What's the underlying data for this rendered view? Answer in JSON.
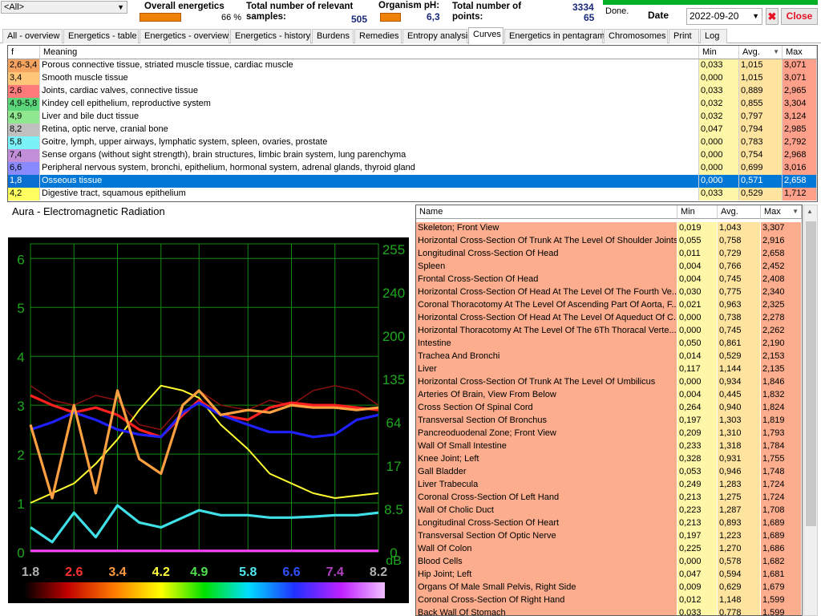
{
  "header": {
    "filter_select": "<All>",
    "overall_energetics_label": "Overall energetics",
    "overall_energetics_value": "66 %",
    "overall_energetics_level": 0.66,
    "relevant_samples_label": "Total number of relevant samples:",
    "relevant_samples_value": "505",
    "organism_ph_label": "Organism pH:",
    "organism_ph_value": "6,3",
    "total_points_label": "Total number of points:",
    "total_points_value_top": "3334",
    "total_points_value": "65",
    "status": "Done.",
    "date_label": "Date",
    "date_value": "2022-09-20",
    "close_label": "Close",
    "colors": {
      "swatch": "#f0820a",
      "progress": "#06b025",
      "close_x": "#e81123"
    }
  },
  "tabs": [
    {
      "label": "All - overview"
    },
    {
      "label": "Energetics - table"
    },
    {
      "label": "Energetics - overview"
    },
    {
      "label": "Energetics - history"
    },
    {
      "label": "Burdens"
    },
    {
      "label": "Remedies"
    },
    {
      "label": "Entropy analysis"
    },
    {
      "label": "Curves",
      "active": true
    },
    {
      "label": "Energetics in pentagram"
    },
    {
      "label": "Chromosomes"
    },
    {
      "label": "Print"
    },
    {
      "label": "Log"
    }
  ],
  "frequency_table": {
    "columns": [
      "f",
      "Meaning",
      "Min",
      "Avg.",
      "Max"
    ],
    "rows": [
      {
        "f": "2,6-3,4",
        "meaning": "Porous connective tissue, striated muscle tissue, cardiac muscle",
        "min": "0,033",
        "avg": "1,015",
        "max": "3,071",
        "color": "#f4a460"
      },
      {
        "f": "3,4",
        "meaning": "Smooth muscle tissue",
        "min": "0,000",
        "avg": "1,015",
        "max": "3,071",
        "color": "#ffc67a"
      },
      {
        "f": "2,6",
        "meaning": "Joints, cardiac valves, connective tissue",
        "min": "0,033",
        "avg": "0,889",
        "max": "2,965",
        "color": "#ff7b7b"
      },
      {
        "f": "4,9-5,8",
        "meaning": "Kindey cell epithelium, reproductive system",
        "min": "0,032",
        "avg": "0,855",
        "max": "3,304",
        "color": "#5bd67a"
      },
      {
        "f": "4,9",
        "meaning": "Liver and bile duct tissue",
        "min": "0,032",
        "avg": "0,797",
        "max": "3,124",
        "color": "#8fe78f"
      },
      {
        "f": "8,2",
        "meaning": "Retina, optic nerve, cranial bone",
        "min": "0,047",
        "avg": "0,794",
        "max": "2,985",
        "color": "#c0c0c0"
      },
      {
        "f": "5,8",
        "meaning": "Goitre, lymph, upper airways, lymphatic system, spleen, ovaries, prostate",
        "min": "0,000",
        "avg": "0,783",
        "max": "2,792",
        "color": "#7af2f7"
      },
      {
        "f": "7,4",
        "meaning": "Sense organs (without sight strength), brain structures, limbic brain system, lung parenchyma",
        "min": "0,000",
        "avg": "0,754",
        "max": "2,968",
        "color": "#c38ed8"
      },
      {
        "f": "6,6",
        "meaning": "Peripheral nervous system, bronchi, epithelium, hormonal system, adrenal glands, thyroid gland",
        "min": "0,000",
        "avg": "0,699",
        "max": "3,016",
        "color": "#8a8aff"
      },
      {
        "f": "1,8",
        "meaning": "Osseous tissue",
        "min": "0,000",
        "avg": "0,571",
        "max": "2,658",
        "color": "#0a6fd0",
        "selected": true
      },
      {
        "f": "4,2",
        "meaning": "Digestive tract, squamous epithelium",
        "min": "0,033",
        "avg": "0,529",
        "max": "1,712",
        "color": "#ffff60"
      }
    ]
  },
  "chart_title": "Aura - Electromagnetic Radiation",
  "chart_data": {
    "type": "line",
    "x": [
      1.8,
      2.2,
      2.6,
      3.0,
      3.4,
      3.8,
      4.2,
      4.6,
      4.9,
      5.3,
      5.8,
      6.2,
      6.6,
      7.0,
      7.4,
      7.8,
      8.2
    ],
    "x_ticks": [
      "1.8",
      "2.6",
      "3.4",
      "4.2",
      "4.9",
      "5.8",
      "6.6",
      "7.4",
      "8.2"
    ],
    "x_tick_colors": [
      "#b0b0b0",
      "#ff3030",
      "#ff9a40",
      "#ffff40",
      "#50e050",
      "#50e8f0",
      "#3050ff",
      "#b040c0",
      "#b0b0b0"
    ],
    "y_left_ticks": [
      "0",
      "1",
      "2",
      "3",
      "4",
      "5",
      "6"
    ],
    "y_right_ticks": [
      "0",
      "8.5",
      "17",
      "64",
      "135",
      "200",
      "240",
      "255"
    ],
    "y_right_unit": "dB",
    "ylim": [
      0,
      6.3
    ],
    "grid": true,
    "series": [
      {
        "color": "#ffff30",
        "values": [
          1.0,
          1.2,
          1.4,
          1.8,
          2.3,
          2.9,
          3.4,
          3.3,
          3.15,
          2.6,
          2.1,
          1.6,
          1.4,
          1.2,
          1.1,
          1.15,
          1.2
        ]
      },
      {
        "color": "#ff2020",
        "values": [
          3.2,
          3.0,
          2.85,
          2.95,
          2.8,
          2.5,
          2.35,
          2.8,
          3.1,
          2.8,
          2.7,
          2.95,
          3.05,
          3.0,
          3.0,
          2.95,
          2.9
        ]
      },
      {
        "color": "#2020ff",
        "values": [
          2.5,
          2.65,
          2.85,
          2.7,
          2.5,
          2.4,
          2.35,
          2.85,
          3.05,
          2.8,
          2.6,
          2.45,
          2.45,
          2.35,
          2.4,
          2.7,
          2.8
        ]
      },
      {
        "color": "#ffa040",
        "values": [
          2.6,
          1.1,
          3.0,
          1.2,
          3.3,
          1.9,
          1.6,
          3.0,
          3.3,
          2.8,
          2.9,
          2.85,
          3.0,
          2.95,
          2.95,
          2.9,
          2.95
        ]
      },
      {
        "color": "#40e0e8",
        "values": [
          0.5,
          0.2,
          0.8,
          0.3,
          0.95,
          0.6,
          0.5,
          0.7,
          0.85,
          0.75,
          0.75,
          0.7,
          0.7,
          0.72,
          0.75,
          0.75,
          0.8
        ]
      },
      {
        "color": "#ff40ff",
        "values": [
          0.02,
          0.02,
          0.02,
          0.02,
          0.02,
          0.02,
          0.02,
          0.02,
          0.02,
          0.02,
          0.02,
          0.02,
          0.02,
          0.02,
          0.02,
          0.02,
          0.02
        ]
      },
      {
        "color": "#8a1010",
        "values": [
          3.4,
          3.1,
          3.0,
          3.2,
          3.1,
          2.6,
          2.5,
          3.0,
          3.3,
          3.0,
          2.9,
          3.1,
          3.0,
          3.3,
          3.4,
          3.3,
          3.0
        ]
      }
    ]
  },
  "organ_table": {
    "columns": [
      "Name",
      "Min",
      "Avg.",
      "Max"
    ],
    "rows": [
      {
        "name": "Skeleton; Front View",
        "min": "0,019",
        "avg": "1,043",
        "max": "3,307"
      },
      {
        "name": "Horizontal Cross-Section Of Trunk At The Level Of Shoulder Joints",
        "min": "0,055",
        "avg": "0,758",
        "max": "2,916"
      },
      {
        "name": "Longitudinal Cross-Section Of Head",
        "min": "0,011",
        "avg": "0,729",
        "max": "2,658"
      },
      {
        "name": "Spleen",
        "min": "0,004",
        "avg": "0,766",
        "max": "2,452"
      },
      {
        "name": "Frontal Cross-Section Of Head",
        "min": "0,004",
        "avg": "0,745",
        "max": "2,408"
      },
      {
        "name": "Horizontal Cross-Section Of Head At The Level Of The Fourth Ve...",
        "min": "0,030",
        "avg": "0,775",
        "max": "2,340"
      },
      {
        "name": "Coronal Thoracotomy At The Level Of Ascending Part Of Aorta, F...",
        "min": "0,021",
        "avg": "0,963",
        "max": "2,325"
      },
      {
        "name": "Horizontal Cross-Section Of Head At The Level Of Aqueduct Of C...",
        "min": "0,000",
        "avg": "0,738",
        "max": "2,278"
      },
      {
        "name": "Horizontal Thoracotomy At The Level Of The 6Th Thoracal Verte...",
        "min": "0,000",
        "avg": "0,745",
        "max": "2,262"
      },
      {
        "name": "Intestine",
        "min": "0,050",
        "avg": "0,861",
        "max": "2,190"
      },
      {
        "name": "Trachea And Bronchi",
        "min": "0,014",
        "avg": "0,529",
        "max": "2,153"
      },
      {
        "name": "Liver",
        "min": "0,117",
        "avg": "1,144",
        "max": "2,135"
      },
      {
        "name": "Horizontal Cross-Section Of Trunk At The Level Of Umbilicus",
        "min": "0,000",
        "avg": "0,934",
        "max": "1,846"
      },
      {
        "name": "Arteries Of Brain, View From Below",
        "min": "0,004",
        "avg": "0,445",
        "max": "1,832"
      },
      {
        "name": "Cross Section Of Spinal Cord",
        "min": "0,264",
        "avg": "0,940",
        "max": "1,824"
      },
      {
        "name": "Transversal Section Of Bronchus",
        "min": "0,197",
        "avg": "1,303",
        "max": "1,819"
      },
      {
        "name": "Pancreoduodenal Zone; Front View",
        "min": "0,209",
        "avg": "1,310",
        "max": "1,793"
      },
      {
        "name": "Wall Of Small Intestine",
        "min": "0,233",
        "avg": "1,318",
        "max": "1,784"
      },
      {
        "name": "Knee Joint; Left",
        "min": "0,328",
        "avg": "0,931",
        "max": "1,755"
      },
      {
        "name": "Gall Bladder",
        "min": "0,053",
        "avg": "0,946",
        "max": "1,748"
      },
      {
        "name": "Liver Trabecula",
        "min": "0,249",
        "avg": "1,283",
        "max": "1,724"
      },
      {
        "name": "Coronal Cross-Section Of Left Hand",
        "min": "0,213",
        "avg": "1,275",
        "max": "1,724"
      },
      {
        "name": "Wall Of Cholic Duct",
        "min": "0,223",
        "avg": "1,287",
        "max": "1,708"
      },
      {
        "name": "Longitudinal Cross-Section Of Heart",
        "min": "0,213",
        "avg": "0,893",
        "max": "1,689"
      },
      {
        "name": "Transversal Section Of Optic Nerve",
        "min": "0,197",
        "avg": "1,223",
        "max": "1,689"
      },
      {
        "name": "Wall Of Colon",
        "min": "0,225",
        "avg": "1,270",
        "max": "1,686"
      },
      {
        "name": "Blood Cells",
        "min": "0,000",
        "avg": "0,578",
        "max": "1,682"
      },
      {
        "name": "Hip Joint; Left",
        "min": "0,047",
        "avg": "0,594",
        "max": "1,681"
      },
      {
        "name": "Organs Of Male Small Pelvis, Right Side",
        "min": "0,009",
        "avg": "0,629",
        "max": "1,679"
      },
      {
        "name": "Coronal Cross-Section Of Right Hand",
        "min": "0,012",
        "avg": "1,148",
        "max": "1,599"
      },
      {
        "name": "Back Wall Of Stomach",
        "min": "0,033",
        "avg": "0,778",
        "max": "1,599"
      }
    ]
  }
}
